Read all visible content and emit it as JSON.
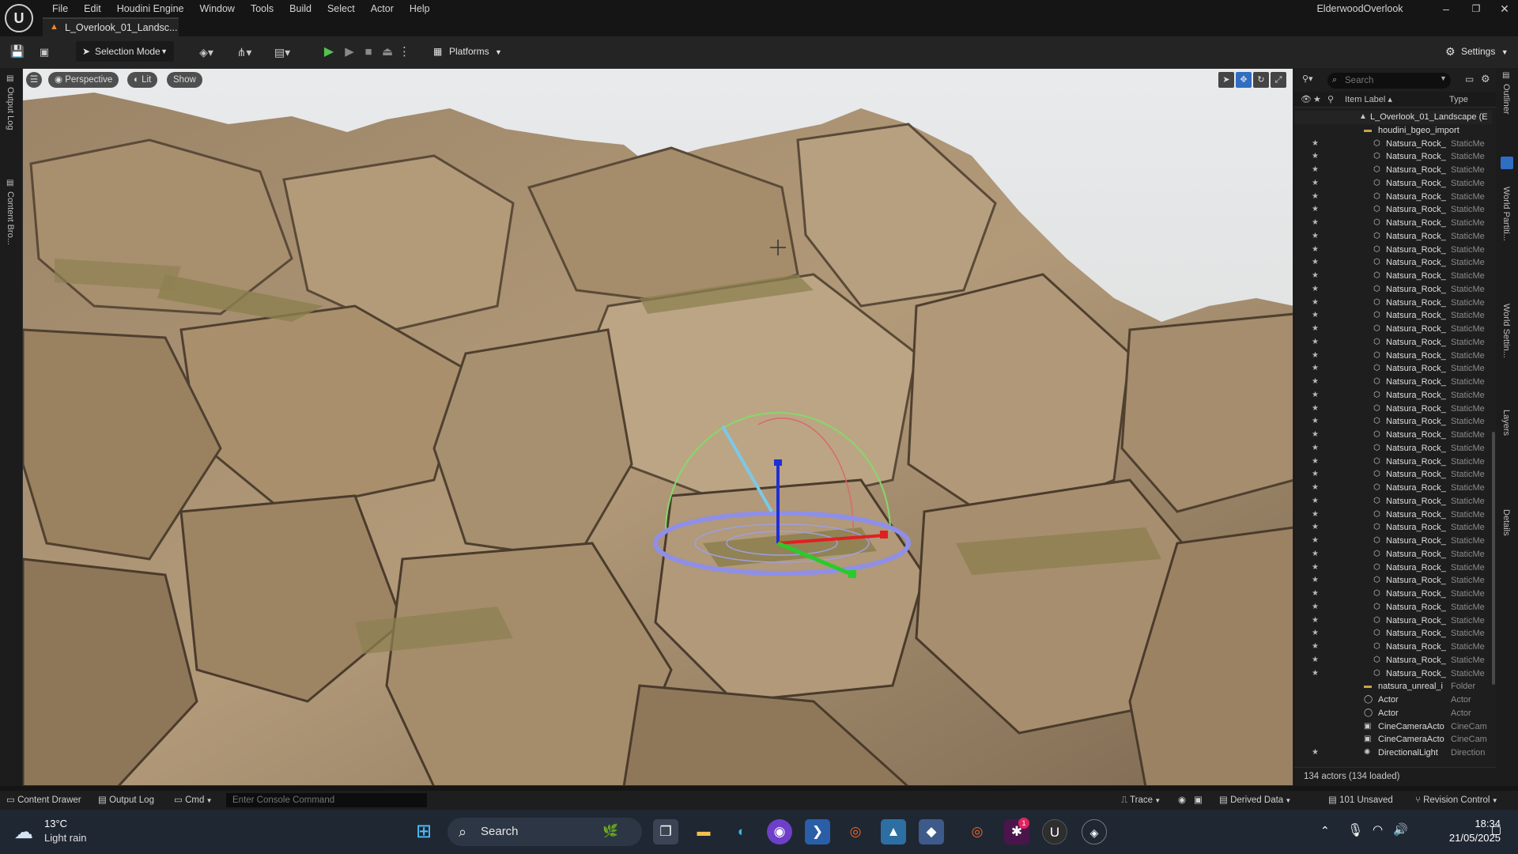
{
  "window": {
    "menu": [
      "File",
      "Edit",
      "Houdini Engine",
      "Window",
      "Tools",
      "Build",
      "Select",
      "Actor",
      "Help"
    ],
    "doc_tab": "L_Overlook_01_Landsc...",
    "project_name": "ElderwoodOverlook",
    "controls": {
      "minimize": "–",
      "maximize": "❐",
      "close": "✕"
    }
  },
  "toolbar": {
    "selection_mode": "Selection Mode",
    "platforms": "Platforms",
    "settings": "Settings"
  },
  "left_dock": {
    "output_log": "Output Log",
    "content_browser": "Content Bro..."
  },
  "viewport": {
    "perspective": "Perspective",
    "lit": "Lit",
    "show": "Show"
  },
  "outliner": {
    "search_placeholder": "Search",
    "header": {
      "label": "Item Label ▴",
      "type": "Type"
    },
    "landscape_row": "L_Overlook_01_Landscape (E",
    "folder_row": "houdini_bgeo_import",
    "rock_label": "Natsura_Rock_",
    "rock_type": "StaticMe",
    "rock_count": 41,
    "tail_rows": [
      {
        "label": "natsura_unreal_i",
        "type": "Folder",
        "icon": "folder-icon"
      },
      {
        "label": "Actor",
        "type": "Actor",
        "icon": "actor-icon"
      },
      {
        "label": "Actor",
        "type": "Actor",
        "icon": "actor-icon"
      },
      {
        "label": "CineCameraActo",
        "type": "CineCam",
        "icon": "camera-icon"
      },
      {
        "label": "CineCameraActo",
        "type": "CineCam",
        "icon": "camera-icon"
      },
      {
        "label": "DirectionalLight",
        "type": "Direction",
        "icon": "light-icon"
      }
    ],
    "status": "134 actors (134 loaded)"
  },
  "right_dock": {
    "outliner": "Outliner",
    "world_partition": "World Partiti...",
    "world_settings": "World Settin...",
    "layers": "Layers",
    "details": "Details"
  },
  "statusbar": {
    "content_drawer": "Content Drawer",
    "output_log": "Output Log",
    "cmd": "Cmd",
    "console_placeholder": "Enter Console Command",
    "trace": "Trace",
    "derived_data": "Derived Data",
    "unsaved": "101 Unsaved",
    "revision_control": "Revision Control"
  },
  "taskbar": {
    "weather_temp": "13°C",
    "weather_desc": "Light rain",
    "search": "Search",
    "time": "18:34",
    "date": "21/05/2025",
    "notification_badge": "1"
  }
}
